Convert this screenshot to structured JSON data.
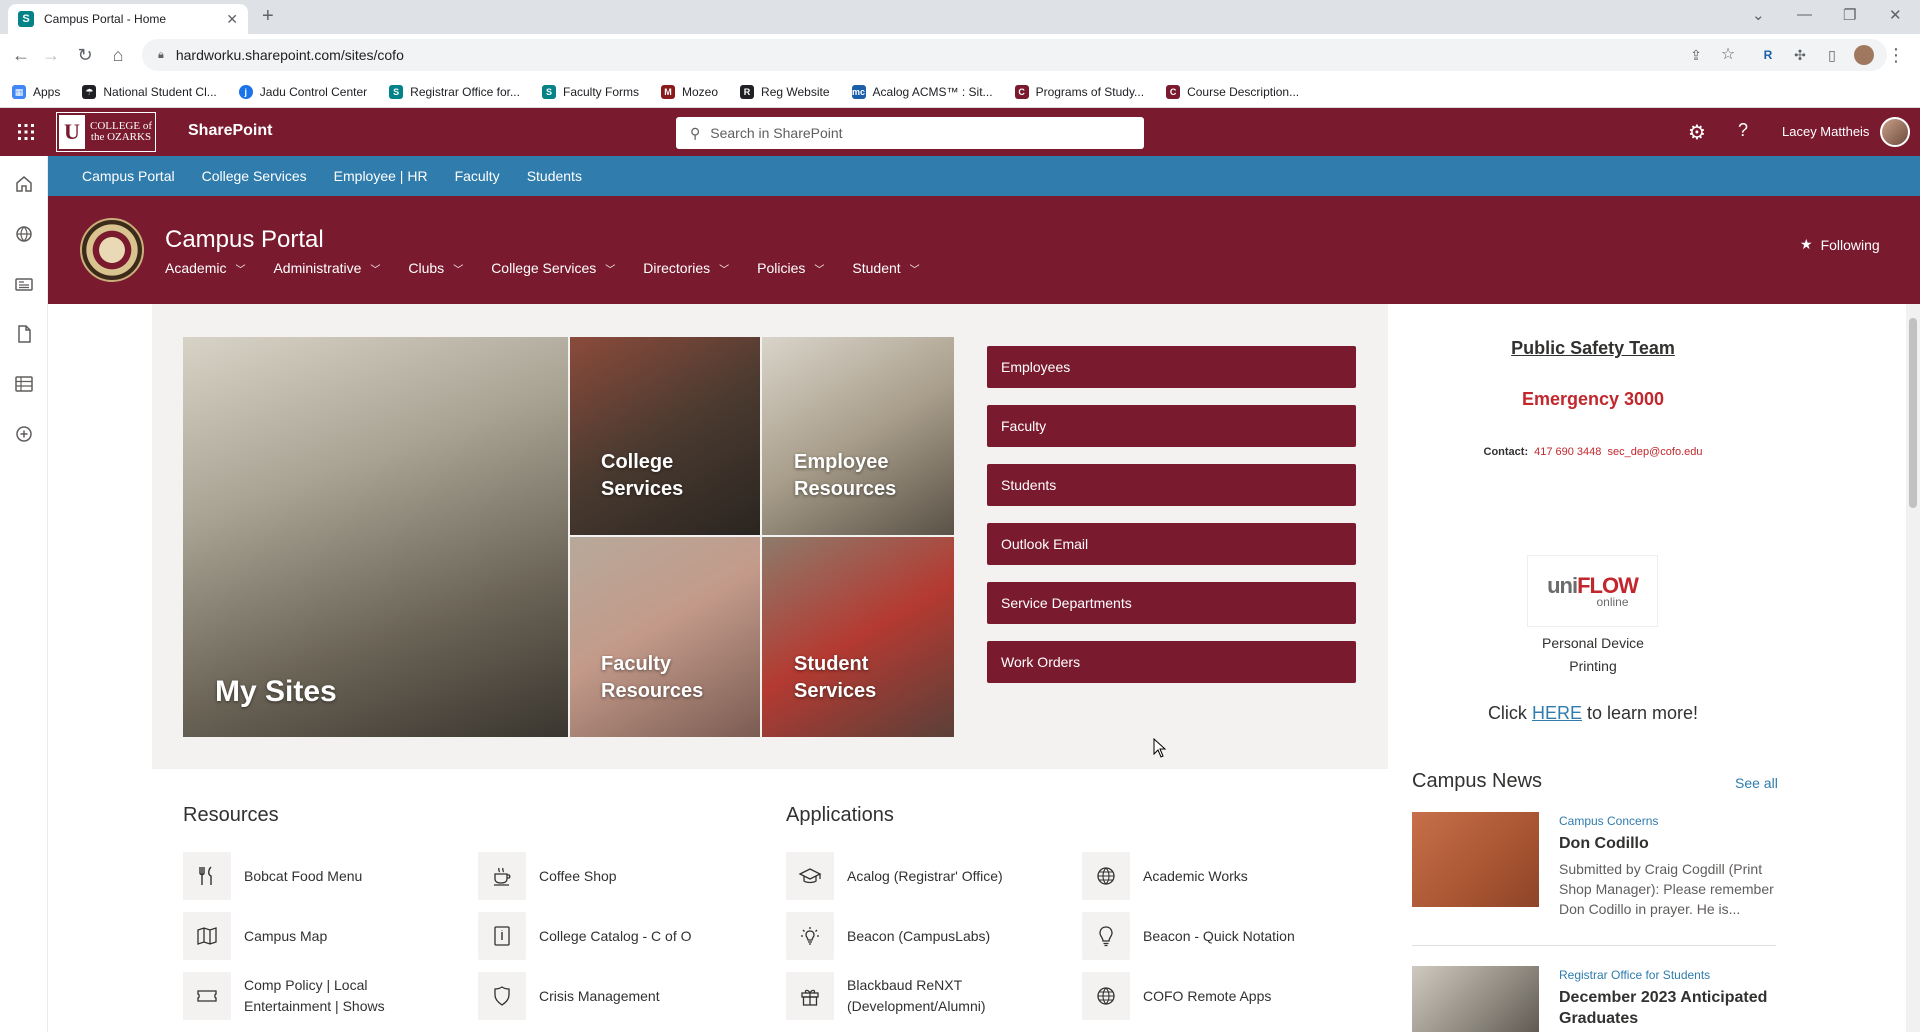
{
  "browser": {
    "tab_title": "Campus Portal - Home",
    "url": "hardworku.sharepoint.com/sites/cofo",
    "bookmarks": [
      {
        "label": "Apps",
        "color": "#4285f4"
      },
      {
        "label": "National Student Cl...",
        "color": "#202124"
      },
      {
        "label": "Jadu Control Center",
        "color": "#1a73e8"
      },
      {
        "label": "Registrar Office for...",
        "color": "#038387"
      },
      {
        "label": "Faculty Forms",
        "color": "#038387"
      },
      {
        "label": "Mozeo",
        "color": "#8b1a1a"
      },
      {
        "label": "Reg Website",
        "color": "#202124"
      },
      {
        "label": "Acalog ACMS™ : Sit...",
        "color": "#1a5fa8"
      },
      {
        "label": "Programs of Study...",
        "color": "#7a1a2e"
      },
      {
        "label": "Course Description...",
        "color": "#7a1a2e"
      }
    ]
  },
  "suite": {
    "logo_letter": "U",
    "logo_text": "COLLEGE of the OZARKS",
    "app_name": "SharePoint",
    "search_placeholder": "Search in SharePoint",
    "user_name": "Lacey Mattheis"
  },
  "hub_nav": [
    "Campus Portal",
    "College Services",
    "Employee | HR",
    "Faculty",
    "Students"
  ],
  "site": {
    "title": "Campus Portal",
    "nav": [
      "Academic",
      "Administrative",
      "Clubs",
      "College Services",
      "Directories",
      "Policies",
      "Student"
    ],
    "following_label": "Following"
  },
  "tiles": {
    "my_sites": "My Sites",
    "college_services": "College Services",
    "employee_resources": "Employee Resources",
    "faculty_resources": "Faculty Resources",
    "student_services": "Student Services"
  },
  "quick_links": [
    "Employees",
    "Faculty",
    "Students",
    "Outlook Email",
    "Service Departments",
    "Work Orders"
  ],
  "safety": {
    "title": "Public Safety Team",
    "emergency": "Emergency 3000",
    "contact_label": "Contact:",
    "phone": "417 690 3448",
    "email": "sec_dep@cofo.edu",
    "uniflow_a": "uni",
    "uniflow_b": "FLOW",
    "uniflow_c": "online",
    "pdp_line1": "Personal Device",
    "pdp_line2": "Printing",
    "click_pre": "Click",
    "click_link": "HERE",
    "click_post": "to learn more!"
  },
  "resources": {
    "title": "Resources",
    "items": [
      {
        "label": "Bobcat Food Menu",
        "icon": "fork-knife-icon"
      },
      {
        "label": "Coffee Shop",
        "icon": "coffee-icon"
      },
      {
        "label": "Campus Map",
        "icon": "map-icon"
      },
      {
        "label": "College Catalog - C of O",
        "icon": "book-icon"
      },
      {
        "label": "Comp Policy | Local Entertainment | Shows",
        "icon": "ticket-icon"
      },
      {
        "label": "Crisis Management",
        "icon": "shield-icon"
      }
    ]
  },
  "applications": {
    "title": "Applications",
    "items": [
      {
        "label": "Acalog (Registrar' Office)",
        "icon": "graduation-cap-icon"
      },
      {
        "label": "Academic Works",
        "icon": "globe-icon"
      },
      {
        "label": "Beacon (CampusLabs)",
        "icon": "lightbulb-glow-icon"
      },
      {
        "label": "Beacon - Quick Notation",
        "icon": "lightbulb-icon"
      },
      {
        "label": "Blackbaud ReNXT (Development/Alumni)",
        "icon": "gift-icon"
      },
      {
        "label": "COFO Remote Apps",
        "icon": "globe-icon"
      }
    ]
  },
  "news": {
    "title": "Campus News",
    "see_all": "See all",
    "items": [
      {
        "category": "Campus Concerns",
        "title": "Don Codillo",
        "body": "Submitted by Craig Cogdill (Print Shop Manager): Please remember Don Codillo in prayer.  He is...",
        "color": "#c0643e"
      },
      {
        "category": "Registrar Office for Students",
        "title": "December 2023 Anticipated Graduates",
        "body": "",
        "color": "#8f8a80"
      }
    ]
  }
}
